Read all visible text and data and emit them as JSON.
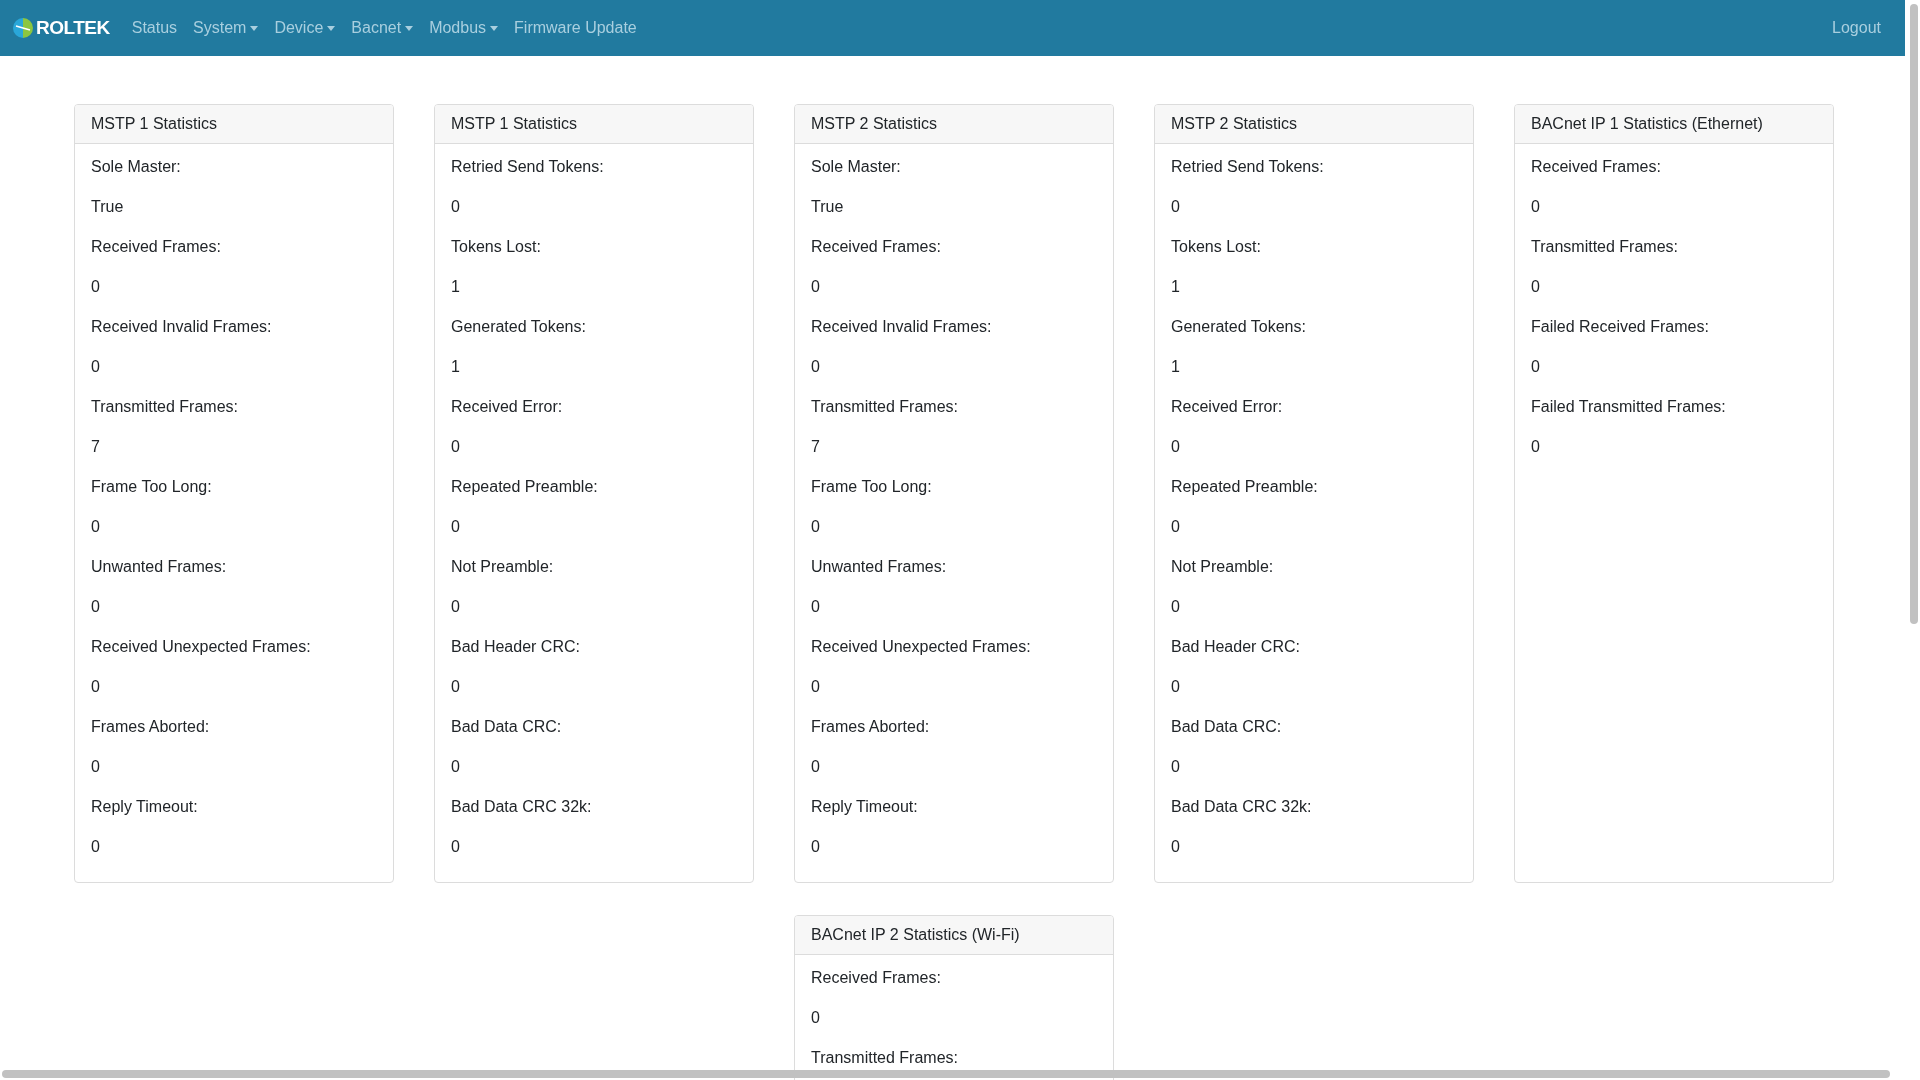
{
  "navbar": {
    "brand": "ROLTEK",
    "items": [
      {
        "label": "Status",
        "dropdown": false
      },
      {
        "label": "System",
        "dropdown": true
      },
      {
        "label": "Device",
        "dropdown": true
      },
      {
        "label": "Bacnet",
        "dropdown": true
      },
      {
        "label": "Modbus",
        "dropdown": true
      },
      {
        "label": "Firmware Update",
        "dropdown": false
      }
    ],
    "logout": "Logout"
  },
  "cards": [
    {
      "title": "MSTP 1 Statistics",
      "fields": [
        {
          "label": "Sole Master:",
          "value": "True"
        },
        {
          "label": "Received Frames:",
          "value": "0"
        },
        {
          "label": "Received Invalid Frames:",
          "value": "0"
        },
        {
          "label": "Transmitted Frames:",
          "value": "7"
        },
        {
          "label": "Frame Too Long:",
          "value": "0"
        },
        {
          "label": "Unwanted Frames:",
          "value": "0"
        },
        {
          "label": "Received Unexpected Frames:",
          "value": "0"
        },
        {
          "label": "Frames Aborted:",
          "value": "0"
        },
        {
          "label": "Reply Timeout:",
          "value": "0"
        }
      ]
    },
    {
      "title": "MSTP 1 Statistics",
      "fields": [
        {
          "label": "Retried Send Tokens:",
          "value": "0"
        },
        {
          "label": "Tokens Lost:",
          "value": "1"
        },
        {
          "label": "Generated Tokens:",
          "value": "1"
        },
        {
          "label": "Received Error:",
          "value": "0"
        },
        {
          "label": "Repeated Preamble:",
          "value": "0"
        },
        {
          "label": "Not Preamble:",
          "value": "0"
        },
        {
          "label": "Bad Header CRC:",
          "value": "0"
        },
        {
          "label": "Bad Data CRC:",
          "value": "0"
        },
        {
          "label": "Bad Data CRC 32k:",
          "value": "0"
        }
      ]
    },
    {
      "title": "MSTP 2 Statistics",
      "fields": [
        {
          "label": "Sole Master:",
          "value": "True"
        },
        {
          "label": "Received Frames:",
          "value": "0"
        },
        {
          "label": "Received Invalid Frames:",
          "value": "0"
        },
        {
          "label": "Transmitted Frames:",
          "value": "7"
        },
        {
          "label": "Frame Too Long:",
          "value": "0"
        },
        {
          "label": "Unwanted Frames:",
          "value": "0"
        },
        {
          "label": "Received Unexpected Frames:",
          "value": "0"
        },
        {
          "label": "Frames Aborted:",
          "value": "0"
        },
        {
          "label": "Reply Timeout:",
          "value": "0"
        }
      ]
    },
    {
      "title": "MSTP 2 Statistics",
      "fields": [
        {
          "label": "Retried Send Tokens:",
          "value": "0"
        },
        {
          "label": "Tokens Lost:",
          "value": "1"
        },
        {
          "label": "Generated Tokens:",
          "value": "1"
        },
        {
          "label": "Received Error:",
          "value": "0"
        },
        {
          "label": "Repeated Preamble:",
          "value": "0"
        },
        {
          "label": "Not Preamble:",
          "value": "0"
        },
        {
          "label": "Bad Header CRC:",
          "value": "0"
        },
        {
          "label": "Bad Data CRC:",
          "value": "0"
        },
        {
          "label": "Bad Data CRC 32k:",
          "value": "0"
        }
      ]
    },
    {
      "title": "BACnet IP 1 Statistics (Ethernet)",
      "fields": [
        {
          "label": "Received Frames:",
          "value": "0"
        },
        {
          "label": "Transmitted Frames:",
          "value": "0"
        },
        {
          "label": "Failed Received Frames:",
          "value": "0"
        },
        {
          "label": "Failed Transmitted Frames:",
          "value": "0"
        }
      ]
    },
    {
      "title": "BACnet IP 2 Statistics (Wi-Fi)",
      "fields": [
        {
          "label": "Received Frames:",
          "value": "0"
        },
        {
          "label": "Transmitted Frames:"
        }
      ]
    }
  ]
}
